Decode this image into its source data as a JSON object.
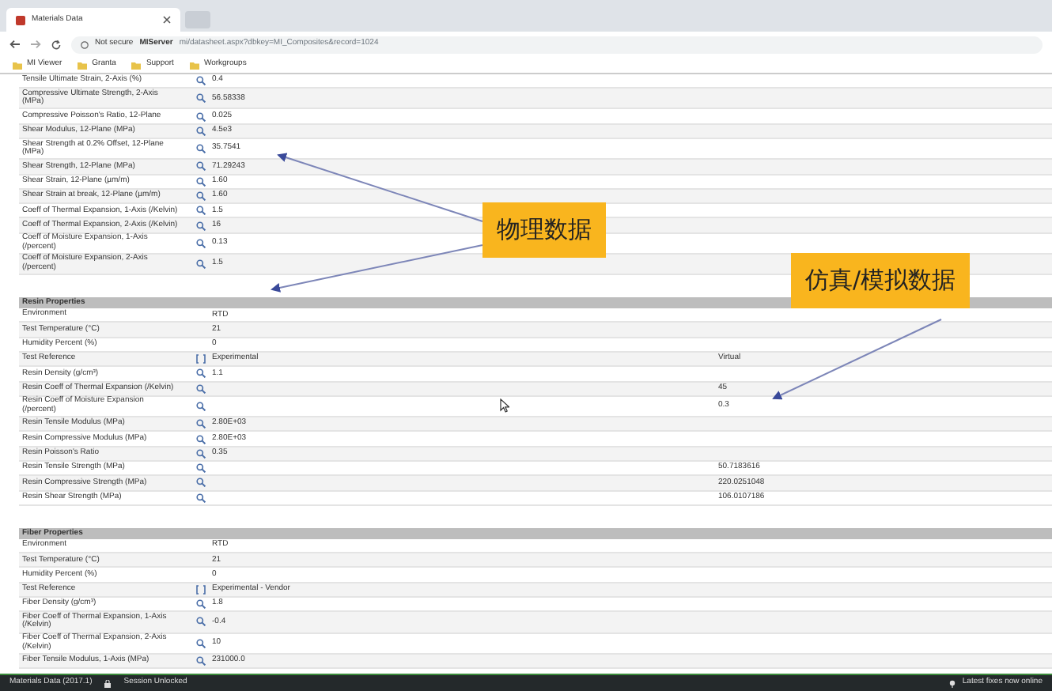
{
  "browser": {
    "tab_title": "Materials Data",
    "security": "Not secure",
    "host": "MIServer",
    "url": "mi/datasheet.aspx?dbkey=MI_Composites&record=1024",
    "bookmarks": [
      "MI Viewer",
      "Granta",
      "Support",
      "Workgroups"
    ]
  },
  "sections": [
    {
      "rows": [
        {
          "label": "Tensile Ultimate Strain, 2-Axis (%)",
          "kind": "search",
          "value": "0.4"
        },
        {
          "label": "Compressive Ultimate Strength, 2-Axis (MPa)",
          "kind": "search",
          "value": "56.58338"
        },
        {
          "label": "Compressive Poisson's Ratio, 12-Plane",
          "kind": "search",
          "value": "0.025"
        },
        {
          "label": "Shear Modulus, 12-Plane (MPa)",
          "kind": "search",
          "value": "4.5e3"
        },
        {
          "label": "Shear Strength at 0.2% Offset, 12-Plane (MPa)",
          "kind": "search",
          "value": "35.7541"
        },
        {
          "label": "Shear Strength, 12-Plane (MPa)",
          "kind": "search",
          "value": "71.29243"
        },
        {
          "label": "Shear Strain, 12-Plane (µm/m)",
          "kind": "search",
          "value": "1.60"
        },
        {
          "label": "Shear Strain at break, 12-Plane (µm/m)",
          "kind": "search",
          "value": "1.60"
        },
        {
          "label": "Coeff of Thermal Expansion, 1-Axis (/Kelvin)",
          "kind": "search",
          "value": "1.5"
        },
        {
          "label": "Coeff of Thermal Expansion, 2-Axis (/Kelvin)",
          "kind": "search",
          "value": "16"
        },
        {
          "label": "Coeff of Moisture Expansion, 1-Axis (/percent)",
          "kind": "search",
          "value": "0.13"
        },
        {
          "label": "Coeff of Moisture Expansion, 2-Axis (/percent)",
          "kind": "search",
          "value": "1.5"
        }
      ]
    },
    {
      "title": "Resin Properties",
      "rows": [
        {
          "label": "Environment",
          "kind": "plain",
          "value": "RTD"
        },
        {
          "label": "Test Temperature (°C)",
          "kind": "plain",
          "value": "21"
        },
        {
          "label": "Humidity Percent (%)",
          "kind": "plain",
          "value": "0"
        },
        {
          "label": "Test Reference",
          "kind": "reference",
          "value": "Experimental",
          "value_2": "Virtual"
        },
        {
          "label": "Resin Density (g/cm³)",
          "kind": "search",
          "value": "1.1"
        },
        {
          "label": "Resin Coeff of Thermal Expansion (/Kelvin)",
          "kind": "search",
          "value_2": "45"
        },
        {
          "label": "Resin Coeff of Moisture Expansion (/percent)",
          "kind": "search",
          "value_2": "0.3"
        },
        {
          "label": "Resin Tensile Modulus (MPa)",
          "kind": "search",
          "value": "2.80E+03"
        },
        {
          "label": "Resin Compressive Modulus (MPa)",
          "kind": "search",
          "value": "2.80E+03"
        },
        {
          "label": "Resin Poisson's Ratio",
          "kind": "search",
          "value": "0.35"
        },
        {
          "label": "Resin Tensile Strength (MPa)",
          "kind": "search",
          "value_2": "50.7183616"
        },
        {
          "label": "Resin Compressive Strength (MPa)",
          "kind": "search",
          "value_2": "220.0251048"
        },
        {
          "label": "Resin Shear Strength (MPa)",
          "kind": "search",
          "value_2": "106.0107186"
        }
      ]
    },
    {
      "title": "Fiber Properties",
      "rows": [
        {
          "label": "Environment",
          "kind": "plain",
          "value": "RTD"
        },
        {
          "label": "Test Temperature (°C)",
          "kind": "plain",
          "value": "21"
        },
        {
          "label": "Humidity Percent (%)",
          "kind": "plain",
          "value": "0"
        },
        {
          "label": "Test Reference",
          "kind": "reference",
          "value": "Experimental - Vendor"
        },
        {
          "label": "Fiber Density (g/cm³)",
          "kind": "search",
          "value": "1.8"
        },
        {
          "label": "Fiber Coeff of Thermal Expansion, 1-Axis (/Kelvin)",
          "kind": "search",
          "value": "-0.4"
        },
        {
          "label": "Fiber Coeff of Thermal Expansion, 2-Axis (/Kelvin)",
          "kind": "search",
          "value": "10"
        },
        {
          "label": "Fiber Tensile Modulus, 1-Axis (MPa)",
          "kind": "search",
          "value": "231000.0"
        }
      ]
    }
  ],
  "callouts": [
    {
      "text": "物理数据"
    },
    {
      "text": "仿真/模拟数据"
    }
  ],
  "status_bar": {
    "left": "Materials Data (2017.1)",
    "session": "Session Unlocked",
    "right": "Latest fixes now online"
  }
}
